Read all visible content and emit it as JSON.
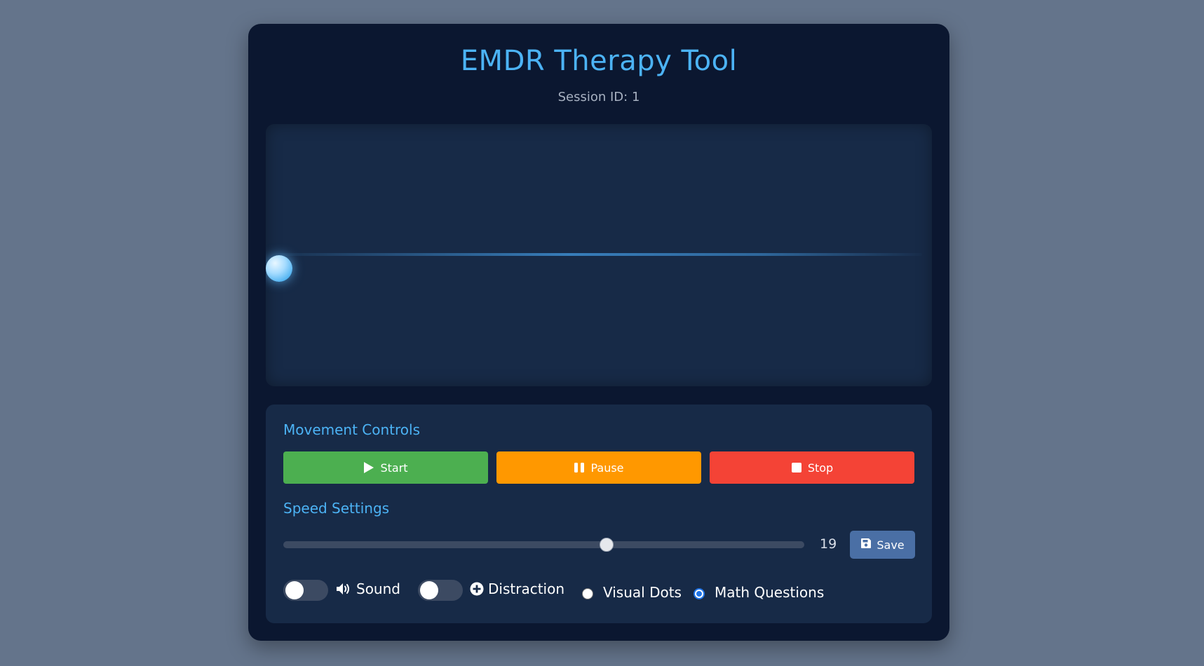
{
  "header": {
    "title": "EMDR Therapy Tool",
    "session": "Session ID: 1"
  },
  "movement": {
    "title": "Movement Controls",
    "start_label": "Start",
    "pause_label": "Pause",
    "stop_label": "Stop",
    "colors": {
      "start": "#4caf50",
      "pause": "#ff9800",
      "stop": "#f44336"
    }
  },
  "speed": {
    "title": "Speed Settings",
    "value": "19",
    "level_fraction": 0.62,
    "save_label": "Save"
  },
  "options": {
    "sound_label": "Sound",
    "sound_on": false,
    "distraction_label": "Distraction",
    "distraction_on": false,
    "radios": [
      {
        "label": "Visual Dots",
        "selected": false
      },
      {
        "label": "Math Questions",
        "selected": true
      }
    ]
  },
  "icons": [
    "play-icon",
    "pause-icon",
    "stop-icon",
    "save-icon",
    "speaker-icon",
    "plus-circle-icon"
  ],
  "colors": {
    "accent": "#4cb3f5",
    "background": "#64748b",
    "panel": "#0b1730",
    "card": "#172a47"
  }
}
